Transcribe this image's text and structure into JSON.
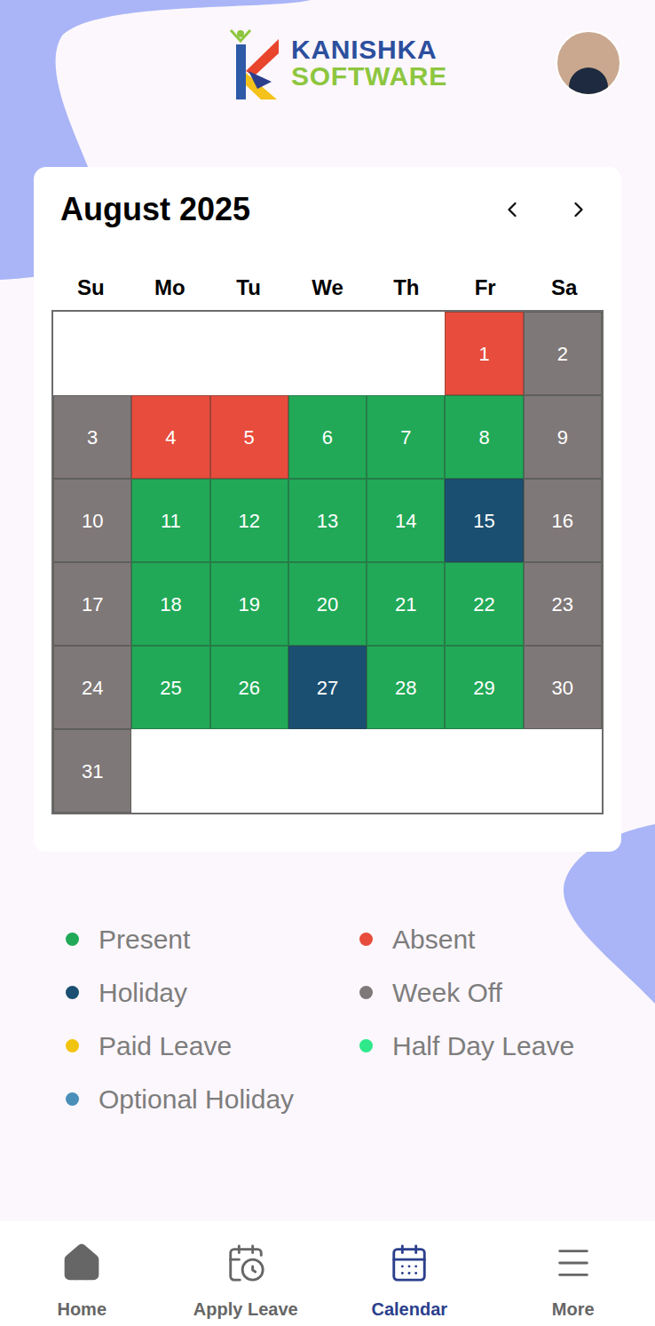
{
  "header": {
    "logo": {
      "line1": "KANISHKA",
      "line2": "SOFTWARE"
    }
  },
  "calendar": {
    "title": "August 2025",
    "weekdays": [
      "Su",
      "Mo",
      "Tu",
      "We",
      "Th",
      "Fr",
      "Sa"
    ],
    "leading_blanks": 5,
    "days": [
      {
        "day": "1",
        "status": "absent",
        "color": "#e74c3c"
      },
      {
        "day": "2",
        "status": "week-off",
        "color": "#7f7878"
      },
      {
        "day": "3",
        "status": "week-off",
        "color": "#7f7878"
      },
      {
        "day": "4",
        "status": "absent",
        "color": "#e74c3c"
      },
      {
        "day": "5",
        "status": "absent",
        "color": "#e74c3c"
      },
      {
        "day": "6",
        "status": "present",
        "color": "#21a957"
      },
      {
        "day": "7",
        "status": "present",
        "color": "#21a957"
      },
      {
        "day": "8",
        "status": "present",
        "color": "#21a957"
      },
      {
        "day": "9",
        "status": "week-off",
        "color": "#7f7878"
      },
      {
        "day": "10",
        "status": "week-off",
        "color": "#7f7878"
      },
      {
        "day": "11",
        "status": "present",
        "color": "#21a957"
      },
      {
        "day": "12",
        "status": "present",
        "color": "#21a957"
      },
      {
        "day": "13",
        "status": "present",
        "color": "#21a957"
      },
      {
        "day": "14",
        "status": "present",
        "color": "#21a957"
      },
      {
        "day": "15",
        "status": "holiday",
        "color": "#1b4f72"
      },
      {
        "day": "16",
        "status": "week-off",
        "color": "#7f7878"
      },
      {
        "day": "17",
        "status": "week-off",
        "color": "#7f7878"
      },
      {
        "day": "18",
        "status": "present",
        "color": "#21a957"
      },
      {
        "day": "19",
        "status": "present",
        "color": "#21a957"
      },
      {
        "day": "20",
        "status": "present",
        "color": "#21a957"
      },
      {
        "day": "21",
        "status": "present",
        "color": "#21a957"
      },
      {
        "day": "22",
        "status": "present",
        "color": "#21a957"
      },
      {
        "day": "23",
        "status": "week-off",
        "color": "#7f7878"
      },
      {
        "day": "24",
        "status": "week-off",
        "color": "#7f7878"
      },
      {
        "day": "25",
        "status": "present",
        "color": "#21a957"
      },
      {
        "day": "26",
        "status": "present",
        "color": "#21a957"
      },
      {
        "day": "27",
        "status": "holiday",
        "color": "#1b4f72"
      },
      {
        "day": "28",
        "status": "present",
        "color": "#21a957"
      },
      {
        "day": "29",
        "status": "present",
        "color": "#21a957"
      },
      {
        "day": "30",
        "status": "week-off",
        "color": "#7f7878"
      },
      {
        "day": "31",
        "status": "week-off",
        "color": "#7f7878"
      }
    ]
  },
  "legend": [
    {
      "label": "Present",
      "color": "#21a957"
    },
    {
      "label": "Absent",
      "color": "#e74c3c"
    },
    {
      "label": "Holiday",
      "color": "#1b4f72"
    },
    {
      "label": "Week Off",
      "color": "#7f7878"
    },
    {
      "label": "Paid Leave",
      "color": "#f1c40f"
    },
    {
      "label": "Half Day Leave",
      "color": "#2ee88a"
    },
    {
      "label": "Optional Holiday",
      "color": "#4a8fb8"
    }
  ],
  "nav": [
    {
      "label": "Home",
      "selected": false
    },
    {
      "label": "Apply Leave",
      "selected": false
    },
    {
      "label": "Calendar",
      "selected": true
    },
    {
      "label": "More",
      "selected": false
    }
  ]
}
